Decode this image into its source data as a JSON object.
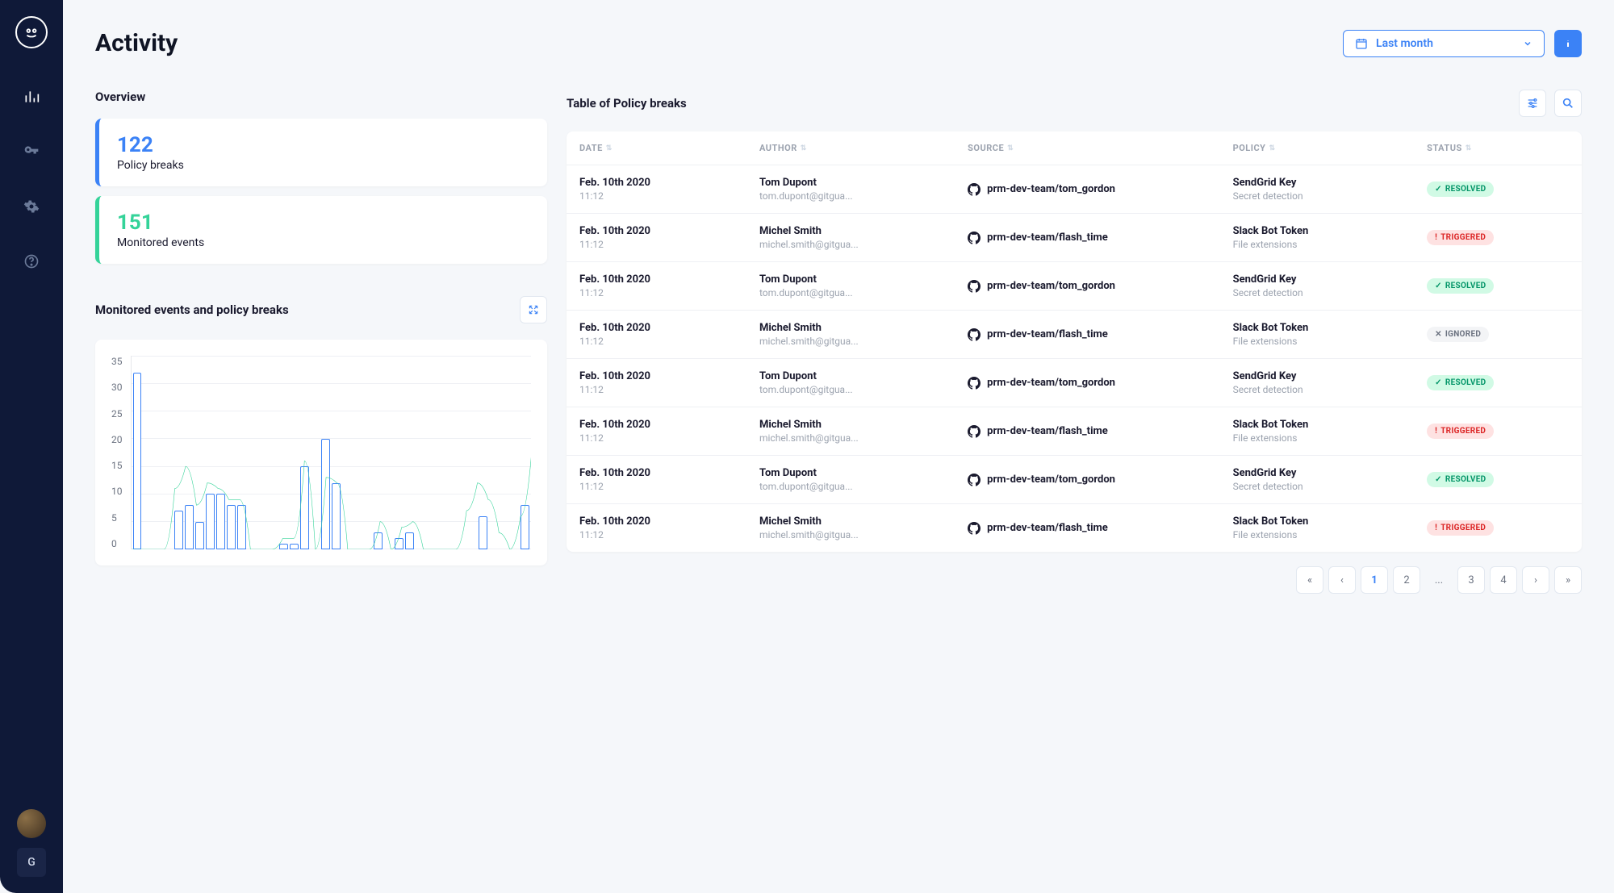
{
  "page_title": "Activity",
  "time_filter": {
    "label": "Last month"
  },
  "sidebar": {
    "badge_letter": "G"
  },
  "overview": {
    "title": "Overview",
    "cards": [
      {
        "value": "122",
        "label": "Policy breaks",
        "accent": "blue"
      },
      {
        "value": "151",
        "label": "Monitored events",
        "accent": "green"
      }
    ]
  },
  "chart": {
    "title": "Monitored events and policy breaks",
    "chart_data": {
      "type": "bar+line",
      "ylim": [
        0,
        35
      ],
      "yticks": [
        35,
        30,
        25,
        20,
        15,
        10,
        5,
        0
      ],
      "series": [
        {
          "name": "Policy breaks",
          "type": "bar",
          "values": [
            32,
            0,
            0,
            0,
            7,
            8,
            5,
            10,
            10,
            8,
            8,
            0,
            0,
            0,
            1,
            1,
            15,
            0,
            20,
            12,
            0,
            0,
            0,
            3,
            0,
            2,
            3,
            0,
            0,
            0,
            0,
            0,
            0,
            6,
            0,
            0,
            0,
            8
          ]
        },
        {
          "name": "Monitored events",
          "type": "line",
          "values": [
            0,
            0,
            0,
            0,
            11,
            15,
            8,
            12,
            11,
            9,
            9,
            0,
            0,
            0,
            2,
            2,
            16,
            0,
            13,
            12,
            0,
            0,
            0,
            5,
            0,
            4,
            5,
            0,
            0,
            0,
            0,
            7,
            12,
            9,
            3,
            0,
            6,
            17
          ]
        }
      ]
    }
  },
  "table": {
    "title": "Table of Policy breaks",
    "columns": [
      "DATE",
      "AUTHOR",
      "SOURCE",
      "POLICY",
      "STATUS"
    ],
    "rows": [
      {
        "date": "Feb. 10th 2020",
        "time": "11:12",
        "author": "Tom Dupont",
        "email": "tom.dupont@gitgua...",
        "source": "prm-dev-team/tom_gordon",
        "policy": "SendGrid Key",
        "category": "Secret detection",
        "status": "RESOLVED"
      },
      {
        "date": "Feb. 10th 2020",
        "time": "11:12",
        "author": "Michel Smith",
        "email": "michel.smith@gitgua...",
        "source": "prm-dev-team/flash_time",
        "policy": "Slack Bot Token",
        "category": "File extensions",
        "status": "TRIGGERED"
      },
      {
        "date": "Feb. 10th 2020",
        "time": "11:12",
        "author": "Tom Dupont",
        "email": "tom.dupont@gitgua...",
        "source": "prm-dev-team/tom_gordon",
        "policy": "SendGrid Key",
        "category": "Secret detection",
        "status": "RESOLVED"
      },
      {
        "date": "Feb. 10th 2020",
        "time": "11:12",
        "author": "Michel Smith",
        "email": "michel.smith@gitgua...",
        "source": "prm-dev-team/flash_time",
        "policy": "Slack Bot Token",
        "category": "File extensions",
        "status": "IGNORED"
      },
      {
        "date": "Feb. 10th 2020",
        "time": "11:12",
        "author": "Tom Dupont",
        "email": "tom.dupont@gitgua...",
        "source": "prm-dev-team/tom_gordon",
        "policy": "SendGrid Key",
        "category": "Secret detection",
        "status": "RESOLVED"
      },
      {
        "date": "Feb. 10th 2020",
        "time": "11:12",
        "author": "Michel Smith",
        "email": "michel.smith@gitgua...",
        "source": "prm-dev-team/flash_time",
        "policy": "Slack Bot Token",
        "category": "File extensions",
        "status": "TRIGGERED"
      },
      {
        "date": "Feb. 10th 2020",
        "time": "11:12",
        "author": "Tom Dupont",
        "email": "tom.dupont@gitgua...",
        "source": "prm-dev-team/tom_gordon",
        "policy": "SendGrid Key",
        "category": "Secret detection",
        "status": "RESOLVED"
      },
      {
        "date": "Feb. 10th 2020",
        "time": "11:12",
        "author": "Michel Smith",
        "email": "michel.smith@gitgua...",
        "source": "prm-dev-team/flash_time",
        "policy": "Slack Bot Token",
        "category": "File extensions",
        "status": "TRIGGERED"
      }
    ]
  },
  "pagination": {
    "pages": [
      "1",
      "2",
      "...",
      "3",
      "4"
    ],
    "active": "1"
  }
}
